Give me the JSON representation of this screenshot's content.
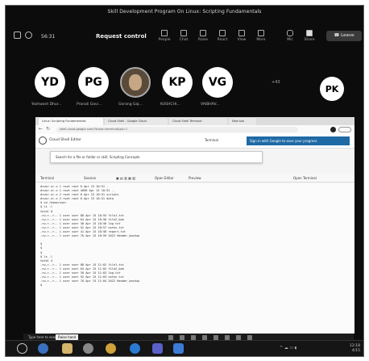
{
  "meeting": {
    "title": "Skill Development Program On Linux: Scripting Fundamentals",
    "time": "56:31",
    "request_control": "Request control",
    "toolbar": [
      "People",
      "Chat",
      "Raise",
      "React",
      "View",
      "More",
      "Mic",
      "Share"
    ],
    "leave": "Leave"
  },
  "participants": [
    {
      "initials": "YD",
      "name": "Yashwant Dhur..."
    },
    {
      "initials": "PG",
      "name": "Pranali Gavi..."
    },
    {
      "initials": "",
      "name": "Gorang Gaj..."
    },
    {
      "initials": "KP",
      "name": "KUSHCHI..."
    },
    {
      "initials": "VG",
      "name": "VAIBHAV..."
    },
    {
      "initials": "PK",
      "name": ""
    }
  ],
  "participants_more": "+43",
  "browser": {
    "tabs": [
      "Linux: Scripting Fundamentals",
      "Cloud Shell - Google Cloud",
      "Cloud Shell Terminal",
      "New tab"
    ],
    "url": "shell.cloud.google.com/?show=terminal&pli=1",
    "app_name": "Cloud Shell Editor",
    "tag": "Terminal",
    "signin_banner": "Sign in with Google to save your progress",
    "search_text": "Search for a file or folder or skill: Scripting Concepts",
    "toolbar": [
      "Terminal",
      "Session",
      "Open Editor",
      "Preview",
      "Open Terminal"
    ]
  },
  "terminal_lines": [
    "drwxr-xr-x 1 root root 0 Apr 15 10:51 .",
    "drwxr-xr-x 1 root root 4096 Apr 15 10:51 ..",
    "drwxr-xr-x 2 root root 0 Apr 15 10:51 scripts",
    "drwxr-xr-x 2 root root 0 Apr 15 10:51 data",
    "$ cd /home/user",
    "$ ls -l",
    "total 0",
    "-rw-r--r-- 1 user user 88 Apr 15 10:55 file1.txt",
    "-rw-r--r-- 1 user user 64 Apr 15 10:56 file2_bak",
    "-rw-r--r-- 1 user user 30 Apr 15 10:56 log.txt",
    "-rw-r--r-- 1 user user 52 Apr 15 10:57 notes.txt",
    "-rw-r--r-- 1 user user 41 Apr 15 10:58 report.txt",
    "-rw-r--r-- 1 user user 70 Apr 15 10:59 2022 Header_backup",
    "",
    "$",
    "$",
    "$",
    "$ ls -l",
    "total 4",
    "-rw-r--r-- 1 user user 88 Apr 15 11:02 file1.txt",
    "-rw-r--r-- 1 user user 64 Apr 15 11:02 file2_bak",
    "-rw-r--r-- 1 user user 30 Apr 15 11:03 log.txt",
    "-rw-r--r-- 1 user user 52 Apr 15 11:03 notes.txt",
    "-rw-r--r-- 1 user user 70 Apr 15 11:04 2022 Header_backup",
    "$"
  ],
  "inner_taskbar": {
    "hint": "Type here to search",
    "tooltip": "Raise hand"
  },
  "clock": {
    "time": "12:18",
    "date": "4/15"
  }
}
